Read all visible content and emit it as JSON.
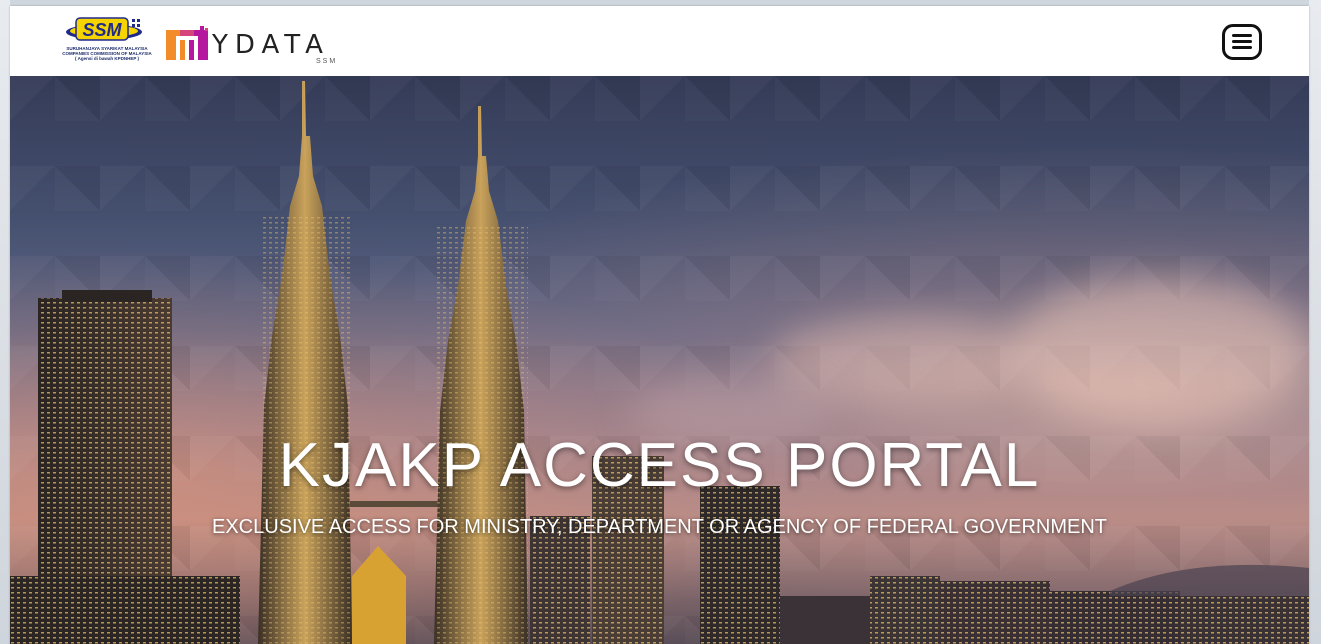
{
  "header": {
    "ssm_logo_text": "SSM",
    "ssm_tagline_lines": [
      "SURUHANJAYA SYARIKAT MALAYSIA",
      "COMPANIES COMMISSION OF MALAYSIA",
      "( Agensi di bawah KPDNHEP )"
    ],
    "mydata_word": "YDATA",
    "mydata_sub": "SSM",
    "menu_icon": "hamburger-menu-icon"
  },
  "hero": {
    "title": "KJAKP ACCESS PORTAL",
    "subtitle": "EXCLUSIVE ACCESS FOR MINISTRY, DEPARTMENT OR AGENCY OF FEDERAL GOVERNMENT"
  },
  "colors": {
    "header_bg": "#ffffff",
    "ssm_yellow": "#f5d400",
    "ssm_blue": "#1f2a8a",
    "mydata_orange": "#f28c28",
    "mydata_magenta": "#b5179e"
  }
}
